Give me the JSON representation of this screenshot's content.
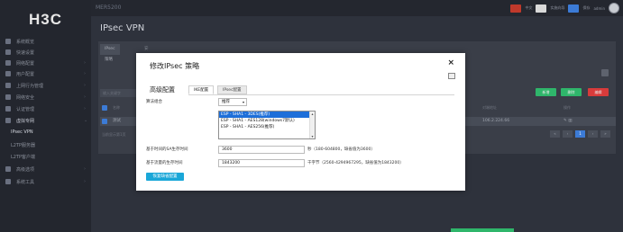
{
  "app": {
    "logo": "H3C",
    "device_name": "MER5200",
    "top_labels": [
      "中文",
      "实施向导",
      "保存",
      "admin"
    ]
  },
  "sidebar": {
    "items": [
      {
        "label": "系统概览"
      },
      {
        "label": "快速设置"
      },
      {
        "label": "网络配置"
      },
      {
        "label": "用户配置"
      },
      {
        "label": "上网行为管理"
      },
      {
        "label": "网络安全"
      },
      {
        "label": "认证管理"
      },
      {
        "label": "虚拟专网"
      },
      {
        "label": "IPsec VPN"
      },
      {
        "label": "L2TP服务器"
      },
      {
        "label": "L2TP客户端"
      },
      {
        "label": "高级选项"
      },
      {
        "label": "系统工具"
      }
    ]
  },
  "main": {
    "title": "IPsec VPN",
    "tabs": [
      "IPsec策略",
      "安全提议"
    ],
    "search_placeholder": "输入关键字",
    "actions": [
      "新增",
      "删除",
      "编辑"
    ],
    "table_headers": [
      "名称",
      "对端地址",
      "操作"
    ],
    "row": {
      "name": "测试",
      "peer": "106.2.224.66"
    },
    "pager_text": "当前显示第1页"
  },
  "modal": {
    "title": "修改IPsec 策略",
    "close": "×",
    "section": "高级配置",
    "tabs": [
      "IKE配置",
      "IPsec配置"
    ],
    "algo_label": "算法组合",
    "algo_value": "推荐",
    "algo_options": [
      "ESP - SHA1 - 3DES(推荐)",
      "ESP - SHA1 - AES128(windows7默认)",
      "ESP - SHA1 - AES256(推荐)"
    ],
    "time_label": "基于时间的SA生存时间",
    "time_value": "3600",
    "time_hint": "秒（180-604800，缺省值为3600）",
    "traffic_label": "基于流量的生存时间",
    "traffic_value": "1843200",
    "traffic_hint": "千字节（2560-4294967295，缺省值为1843200）",
    "restore_label": "恢复缺省配置"
  },
  "colors": {
    "accent": "#1e6fd9",
    "restore_button": "#1aa7d8",
    "add_button": "#2fb66b",
    "delete_button": "#d83b3b"
  }
}
